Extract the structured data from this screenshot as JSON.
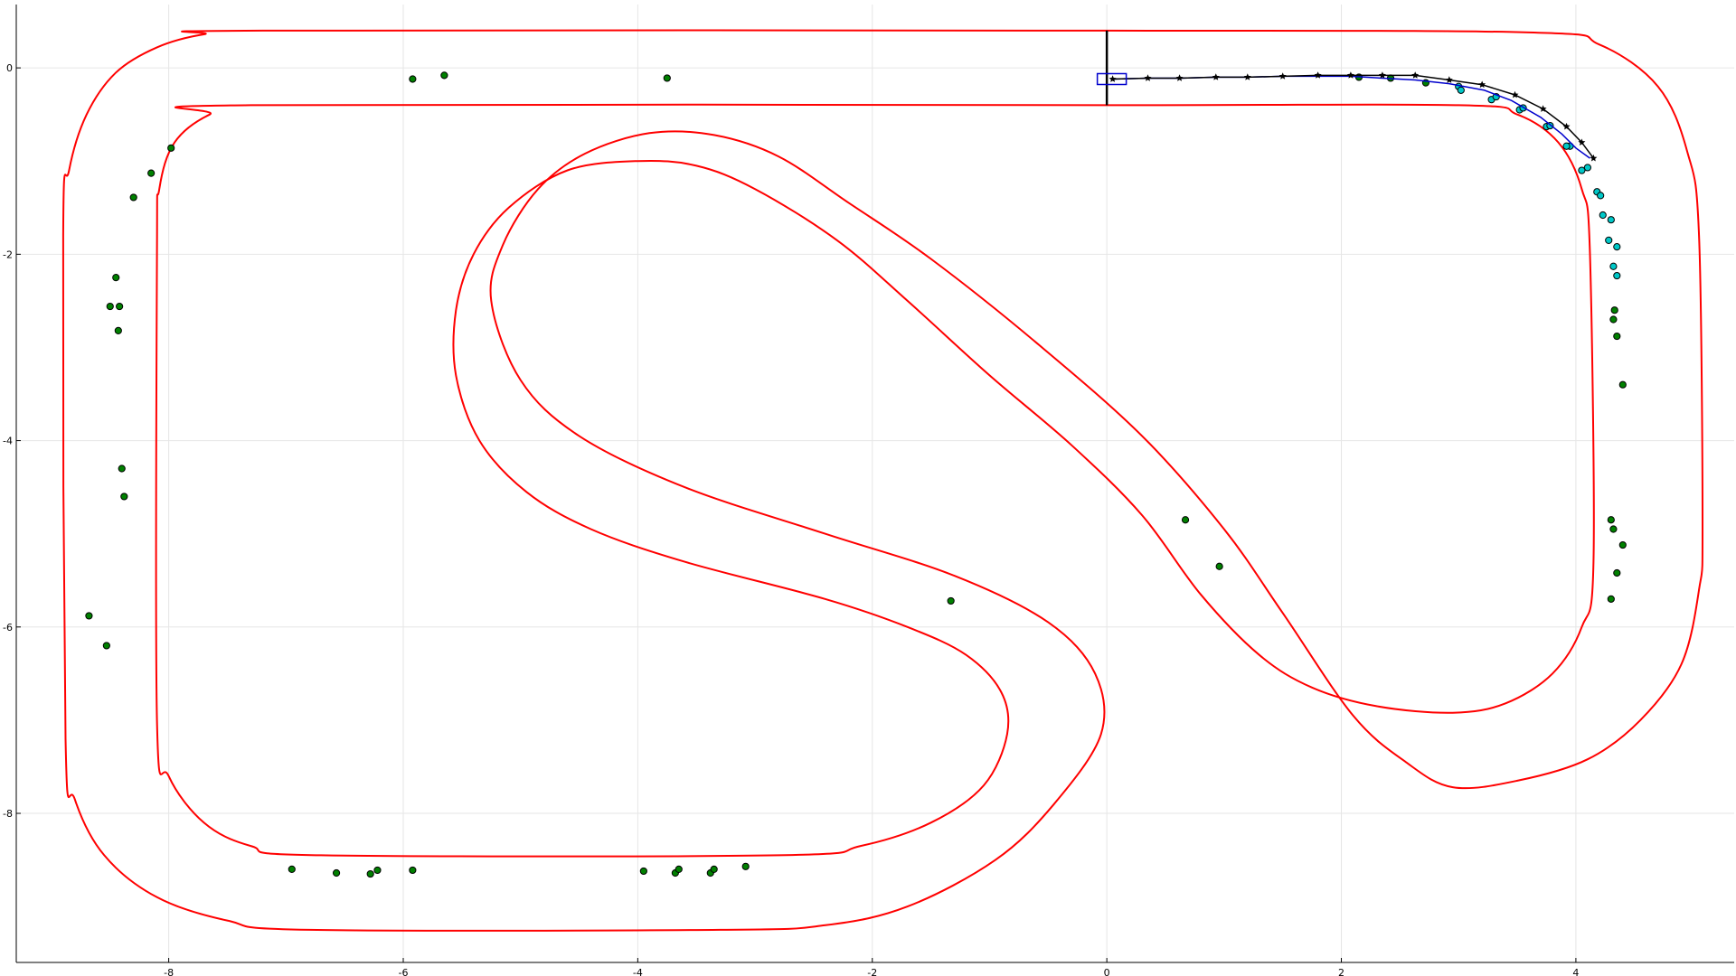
{
  "chart_data": {
    "type": "scatter",
    "title": "",
    "xlabel": "",
    "ylabel": "",
    "xlim": [
      -9.3,
      5.35
    ],
    "ylim": [
      -9.6,
      0.68
    ],
    "grid": true,
    "legend": "none",
    "xticks": [
      -8,
      -6,
      -4,
      -2,
      0,
      2,
      4
    ],
    "yticks": [
      0,
      -2,
      -4,
      -6,
      -8
    ],
    "xtick_labels": [
      "-8",
      "-6",
      "-4",
      "-2",
      "0",
      "2",
      "4"
    ],
    "ytick_labels": [
      "0",
      "-2",
      "-4",
      "-6",
      "-8"
    ],
    "colors": {
      "track": "#ff0000",
      "start_line": "#000000",
      "car_box": "#0000cd",
      "predicted_path": "#0000cd",
      "reference_path": "#000000",
      "landmarks": "#008000",
      "observed_landmarks": "#00c8c8",
      "grid": "#e6e6e6"
    },
    "track_boundaries": [
      {
        "name": "outer",
        "points": [
          [
            0,
            0.4
          ],
          [
            -7.2,
            0.4
          ],
          [
            -7.7,
            0.36
          ],
          [
            -8.1,
            0.22
          ],
          [
            -8.45,
            -0.05
          ],
          [
            -8.7,
            -0.5
          ],
          [
            -8.85,
            -1.1
          ],
          [
            -8.9,
            -1.8
          ],
          [
            -8.88,
            -7.2
          ],
          [
            -8.8,
            -7.85
          ],
          [
            -8.55,
            -8.45
          ],
          [
            -8.1,
            -8.9
          ],
          [
            -7.5,
            -9.15
          ],
          [
            -6.8,
            -9.25
          ],
          [
            -3.3,
            -9.25
          ],
          [
            -2.4,
            -9.2
          ],
          [
            -1.7,
            -9.0
          ],
          [
            -0.95,
            -8.5
          ],
          [
            -0.45,
            -7.9
          ],
          [
            -0.05,
            -7.15
          ],
          [
            -0.1,
            -6.5
          ],
          [
            -0.5,
            -5.95
          ],
          [
            -1.3,
            -5.45
          ],
          [
            -2.4,
            -5.0
          ],
          [
            -3.6,
            -4.5
          ],
          [
            -4.5,
            -3.95
          ],
          [
            -5.0,
            -3.35
          ],
          [
            -5.25,
            -2.5
          ],
          [
            -5.15,
            -1.9
          ],
          [
            -4.85,
            -1.3
          ],
          [
            -4.45,
            -0.92
          ],
          [
            -3.9,
            -0.7
          ],
          [
            -3.35,
            -0.72
          ],
          [
            -2.8,
            -0.95
          ],
          [
            -2.2,
            -1.45
          ],
          [
            -1.5,
            -2.05
          ],
          [
            -0.6,
            -2.95
          ],
          [
            0.3,
            -3.95
          ],
          [
            1.0,
            -4.95
          ],
          [
            1.5,
            -5.85
          ],
          [
            2.1,
            -6.95
          ],
          [
            2.55,
            -7.45
          ],
          [
            2.95,
            -7.72
          ],
          [
            3.5,
            -7.65
          ],
          [
            4.1,
            -7.42
          ],
          [
            4.55,
            -7.0
          ],
          [
            4.9,
            -6.4
          ],
          [
            5.05,
            -5.6
          ],
          [
            5.08,
            -4.9
          ],
          [
            5.05,
            -1.8
          ],
          [
            4.95,
            -0.9
          ],
          [
            4.7,
            -0.2
          ],
          [
            4.2,
            0.25
          ],
          [
            3.6,
            0.38
          ],
          [
            0,
            0.4
          ]
        ]
      },
      {
        "name": "inner",
        "points": [
          [
            0,
            -0.4
          ],
          [
            -7.3,
            -0.4
          ],
          [
            -7.65,
            -0.5
          ],
          [
            -7.95,
            -0.8
          ],
          [
            -8.08,
            -1.3
          ],
          [
            -8.1,
            -2.0
          ],
          [
            -8.1,
            -7.0
          ],
          [
            -8.0,
            -7.6
          ],
          [
            -7.7,
            -8.1
          ],
          [
            -7.3,
            -8.35
          ],
          [
            -6.7,
            -8.45
          ],
          [
            -2.8,
            -8.45
          ],
          [
            -2.1,
            -8.35
          ],
          [
            -1.5,
            -8.1
          ],
          [
            -1.05,
            -7.7
          ],
          [
            -0.85,
            -7.15
          ],
          [
            -0.9,
            -6.7
          ],
          [
            -1.2,
            -6.3
          ],
          [
            -1.7,
            -6.0
          ],
          [
            -2.4,
            -5.7
          ],
          [
            -3.6,
            -5.3
          ],
          [
            -4.4,
            -4.95
          ],
          [
            -4.95,
            -4.55
          ],
          [
            -5.35,
            -4.0
          ],
          [
            -5.55,
            -3.3
          ],
          [
            -5.55,
            -2.6
          ],
          [
            -5.4,
            -2.0
          ],
          [
            -5.1,
            -1.5
          ],
          [
            -4.6,
            -1.1
          ],
          [
            -4.0,
            -1.0
          ],
          [
            -3.5,
            -1.05
          ],
          [
            -3.0,
            -1.3
          ],
          [
            -2.3,
            -1.85
          ],
          [
            -1.7,
            -2.5
          ],
          [
            -1.0,
            -3.3
          ],
          [
            -0.3,
            -4.05
          ],
          [
            0.3,
            -4.8
          ],
          [
            0.8,
            -5.65
          ],
          [
            1.3,
            -6.3
          ],
          [
            1.75,
            -6.65
          ],
          [
            2.3,
            -6.85
          ],
          [
            2.95,
            -6.92
          ],
          [
            3.4,
            -6.82
          ],
          [
            3.8,
            -6.5
          ],
          [
            4.05,
            -6.0
          ],
          [
            4.15,
            -5.3
          ],
          [
            4.12,
            -2.0
          ],
          [
            4.05,
            -1.3
          ],
          [
            3.85,
            -0.8
          ],
          [
            3.5,
            -0.5
          ],
          [
            3.0,
            -0.4
          ],
          [
            0,
            -0.4
          ]
        ]
      }
    ],
    "start_line": {
      "x": [
        0,
        0
      ],
      "y": [
        0.4,
        -0.4
      ]
    },
    "car": {
      "x": 0.05,
      "y": -0.12
    },
    "reference_path": {
      "x": [
        0.05,
        0.35,
        0.62,
        0.93,
        1.2,
        1.5,
        1.8,
        2.08,
        2.35,
        2.63,
        2.92,
        3.2,
        3.48,
        3.72,
        3.92,
        4.05,
        4.15
      ],
      "y": [
        -0.12,
        -0.11,
        -0.11,
        -0.1,
        -0.1,
        -0.09,
        -0.08,
        -0.08,
        -0.08,
        -0.08,
        -0.13,
        -0.18,
        -0.29,
        -0.44,
        -0.63,
        -0.8,
        -0.97
      ]
    },
    "predicted_path": {
      "x": [
        0.05,
        0.35,
        0.62,
        0.93,
        1.2,
        1.5,
        1.8,
        2.08,
        2.35,
        2.63,
        2.92,
        3.22,
        3.45,
        3.7,
        3.88,
        4.0,
        4.12
      ],
      "y": [
        -0.12,
        -0.11,
        -0.11,
        -0.1,
        -0.1,
        -0.09,
        -0.09,
        -0.09,
        -0.11,
        -0.13,
        -0.17,
        -0.24,
        -0.35,
        -0.53,
        -0.71,
        -0.86,
        -0.97
      ]
    },
    "landmarks": {
      "x": [
        -5.92,
        -5.65,
        -3.75,
        -7.98,
        -8.15,
        -8.3,
        -8.45,
        -8.5,
        -8.42,
        -8.43,
        -8.4,
        -8.38,
        -8.68,
        -8.53,
        -6.95,
        -6.57,
        -6.28,
        -6.22,
        -5.92,
        -3.95,
        -3.68,
        -3.65,
        -3.38,
        -3.35,
        -3.08,
        -1.33,
        0.67,
        0.96,
        2.15,
        2.42,
        2.72,
        4.33,
        4.32,
        4.35,
        4.4,
        4.3,
        4.32,
        4.4,
        4.35,
        4.3
      ],
      "y": [
        -0.12,
        -0.08,
        -0.11,
        -0.86,
        -1.13,
        -1.39,
        -2.25,
        -2.56,
        -2.56,
        -2.82,
        -4.3,
        -4.6,
        -5.88,
        -6.2,
        -8.6,
        -8.64,
        -8.65,
        -8.61,
        -8.61,
        -8.62,
        -8.64,
        -8.6,
        -8.64,
        -8.6,
        -8.57,
        -5.72,
        -4.85,
        -5.35,
        -0.1,
        -0.11,
        -0.16,
        -2.6,
        -2.7,
        -2.88,
        -3.4,
        -4.85,
        -4.95,
        -5.12,
        -5.42,
        -5.7
      ]
    },
    "observed_landmarks": {
      "x": [
        3.0,
        3.28,
        3.52,
        3.75,
        3.95,
        4.1,
        4.18,
        4.23,
        4.28,
        4.32,
        4.35,
        3.02,
        3.32,
        3.55,
        3.78,
        3.92,
        4.05,
        4.21,
        4.3,
        4.35
      ],
      "y": [
        -0.2,
        -0.34,
        -0.45,
        -0.63,
        -0.84,
        -1.07,
        -1.33,
        -1.58,
        -1.85,
        -2.13,
        -2.23,
        -0.24,
        -0.31,
        -0.43,
        -0.62,
        -0.84,
        -1.1,
        -1.37,
        -1.63,
        -1.92
      ]
    }
  }
}
